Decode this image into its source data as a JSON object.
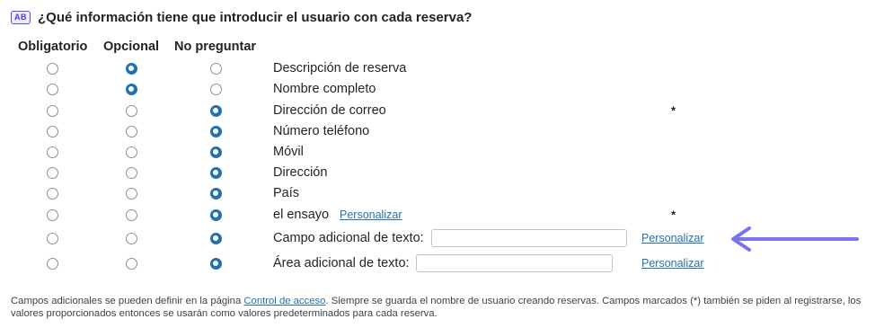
{
  "header": {
    "icon": "ab-form-icon",
    "icon_text": "AB",
    "title": "¿Qué información tiene que introducir el usuario con cada reserva?"
  },
  "columns": {
    "required": "Obligatorio",
    "optional": "Opcional",
    "dont_ask": "No preguntar"
  },
  "fields": [
    {
      "label": "Descripción de reserva",
      "selected": "optional"
    },
    {
      "label": "Nombre completo",
      "selected": "optional"
    },
    {
      "label": "Dirección de correo",
      "selected": "dont_ask",
      "required_marker": "*"
    },
    {
      "label": "Número teléfono",
      "selected": "dont_ask"
    },
    {
      "label": "Móvil",
      "selected": "dont_ask"
    },
    {
      "label": "Dirección",
      "selected": "dont_ask"
    },
    {
      "label": "País",
      "selected": "dont_ask"
    },
    {
      "label": "el ensayo",
      "selected": "dont_ask",
      "link": "Personalizar",
      "required_marker": "*"
    },
    {
      "label": "Campo adicional de texto:",
      "selected": "dont_ask",
      "input_value": "",
      "link": "Personalizar"
    },
    {
      "label": "Área adicional de texto:",
      "selected": "dont_ask",
      "input_value": "",
      "link": "Personalizar"
    }
  ],
  "annotation": {
    "arrow_color": "#7b74f0"
  },
  "footer": {
    "text_before": "Campos adicionales se pueden definir en la página ",
    "link_text": "Control de acceso",
    "text_after": ". Siempre se guarda el nombre de usuario creando reservas. Campos marcados (*) también se piden al registrarse, los valores proporcionados entonces se usarán como valores predeterminados para cada reserva."
  },
  "colors": {
    "accent": "#2271b1",
    "icon": "#5b4fe0"
  }
}
